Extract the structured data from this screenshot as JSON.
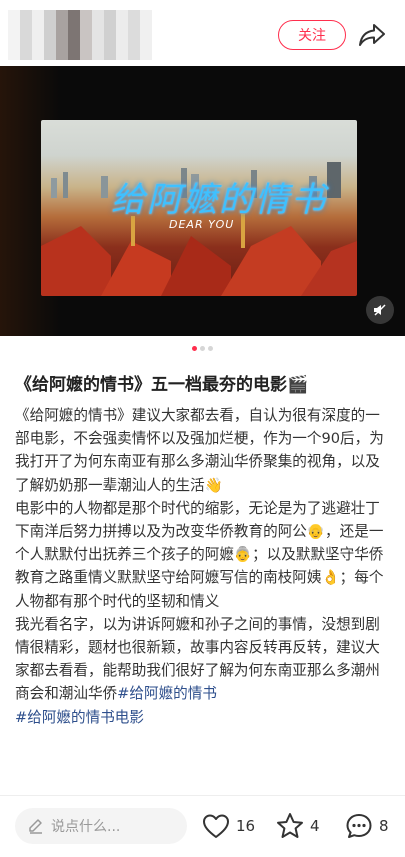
{
  "header": {
    "follow_label": "关注",
    "share_icon": "share-arrow-icon"
  },
  "hero": {
    "screen_title": "给阿嬷的情书",
    "screen_subtitle": "DEAR YOU",
    "mute_icon": "speaker-mute-icon",
    "pagination": {
      "count": 3,
      "active_index": 0
    }
  },
  "post": {
    "title": "《给阿嬷的情书》五一档最夯的电影🎬",
    "paragraphs": [
      "《给阿嬷的情书》建议大家都去看，自认为很有深度的一部电影，不会强卖情怀以及强加烂梗，作为一个90后，为我打开了为何东南亚有那么多潮汕华侨聚集的视角，以及了解奶奶那一辈潮汕人的生活👋",
      "电影中的人物都是那个时代的缩影，无论是为了逃避壮丁下南洋后努力拼搏以及为改变华侨教育的阿公👴，还是一个人默默付出抚养三个孩子的阿嬷👵；以及默默坚守华侨教育之路重情义默默坚守给阿嬷写信的南枝阿姨👌；每个人物都有那个时代的坚韧和情义",
      "我光看名字，以为讲诉阿嬷和孙子之间的事情，没想到剧情很精彩，题材也很新颖，故事内容反转再反转，建议大家都去看看，能帮助我们很好了解为何东南亚那么多潮州商会和潮汕华侨"
    ],
    "tags": [
      "#给阿嬷的情书",
      "#给阿嬷的情书电影"
    ]
  },
  "bottom_bar": {
    "comment_placeholder": "说点什么...",
    "likes": "16",
    "stars": "4",
    "comments": "8"
  },
  "colors": {
    "accent": "#ff2e4d",
    "tag": "#2e4f8c"
  }
}
